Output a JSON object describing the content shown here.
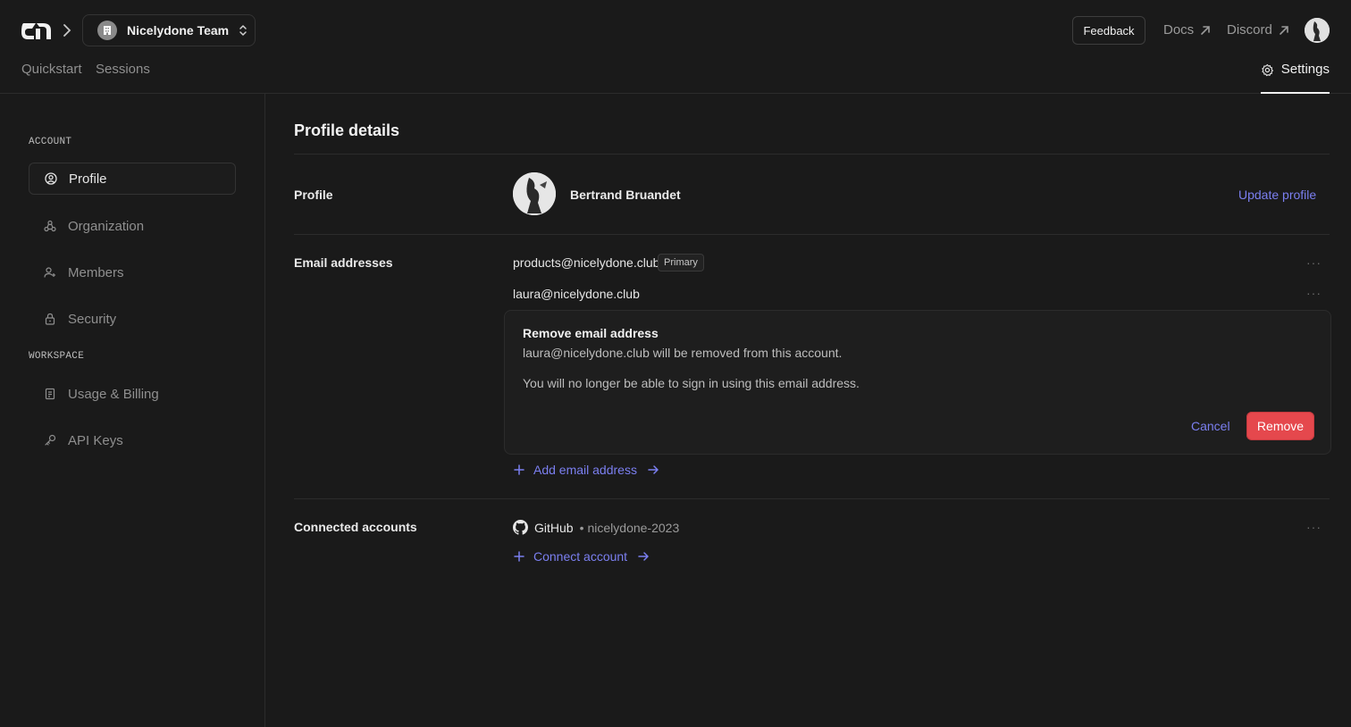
{
  "topbar": {
    "team_name": "Nicelydone Team",
    "feedback_label": "Feedback",
    "docs_label": "Docs",
    "discord_label": "Discord",
    "nav": {
      "quickstart": "Quickstart",
      "sessions": "Sessions",
      "settings": "Settings"
    }
  },
  "sidebar": {
    "account_label": "ACCOUNT",
    "workspace_label": "WORKSPACE",
    "items": [
      {
        "label": "Profile",
        "icon": "user-circle-icon",
        "active": true
      },
      {
        "label": "Organization",
        "icon": "organization-icon"
      },
      {
        "label": "Members",
        "icon": "user-plus-icon"
      },
      {
        "label": "Security",
        "icon": "lock-icon"
      },
      {
        "label": "Usage & Billing",
        "icon": "receipt-icon"
      },
      {
        "label": "API Keys",
        "icon": "key-icon"
      }
    ]
  },
  "main": {
    "title": "Profile details",
    "profile": {
      "label": "Profile",
      "name": "Bertrand Bruandet",
      "update_label": "Update profile"
    },
    "emails": {
      "label": "Email addresses",
      "items": [
        {
          "address": "products@nicelydone.club",
          "badge": "Primary"
        },
        {
          "address": "laura@nicelydone.club"
        }
      ],
      "confirm": {
        "title": "Remove email address",
        "line1": "laura@nicelydone.club will be removed from this account.",
        "line2": "You will no longer be able to sign in using this email address.",
        "cancel_label": "Cancel",
        "remove_label": "Remove"
      },
      "add_label": "Add email address"
    },
    "connected": {
      "label": "Connected accounts",
      "provider": "GitHub",
      "separator": "•",
      "username": "nicelydone-2023",
      "connect_label": "Connect account"
    },
    "menu_glyph": "···"
  },
  "colors": {
    "accent": "#7b7ff0",
    "danger": "#e5484d",
    "background": "#1a1a1a"
  }
}
